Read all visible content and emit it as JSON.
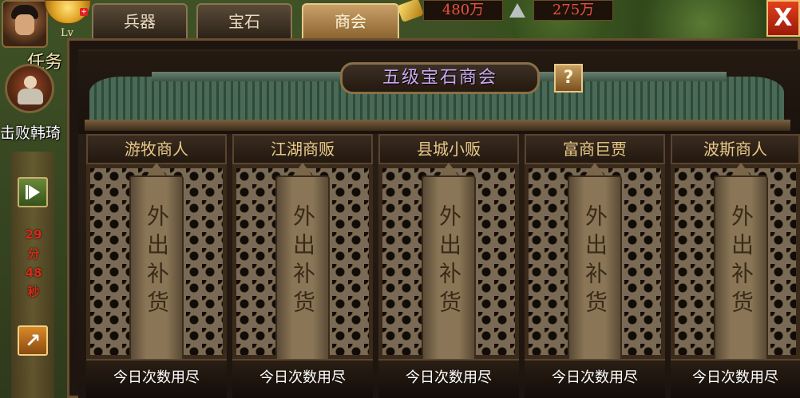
{
  "hud": {
    "level_label": "Lv",
    "quest_label": "任务",
    "quest_name": "击败韩琦",
    "timer": [
      "29",
      "分",
      "48",
      "秒"
    ],
    "resources": [
      {
        "icon": "gold-ingot-icon",
        "value": "480万"
      },
      {
        "icon": "silver-icon",
        "value": "275万"
      }
    ]
  },
  "tabs": [
    {
      "label": "兵器",
      "active": false
    },
    {
      "label": "宝石",
      "active": false
    },
    {
      "label": "商会",
      "active": true
    }
  ],
  "panel": {
    "title": "五级宝石商会",
    "help": "?",
    "close": "X"
  },
  "merchants": [
    {
      "name": "游牧商人",
      "status": "外出补货",
      "footer": "今日次数用尽"
    },
    {
      "name": "江湖商贩",
      "status": "外出补货",
      "footer": "今日次数用尽"
    },
    {
      "name": "县城小贩",
      "status": "外出补货",
      "footer": "今日次数用尽"
    },
    {
      "name": "富商巨贾",
      "status": "外出补货",
      "footer": "今日次数用尽"
    },
    {
      "name": "波斯商人",
      "status": "外出补货",
      "footer": "今日次数用尽"
    }
  ]
}
